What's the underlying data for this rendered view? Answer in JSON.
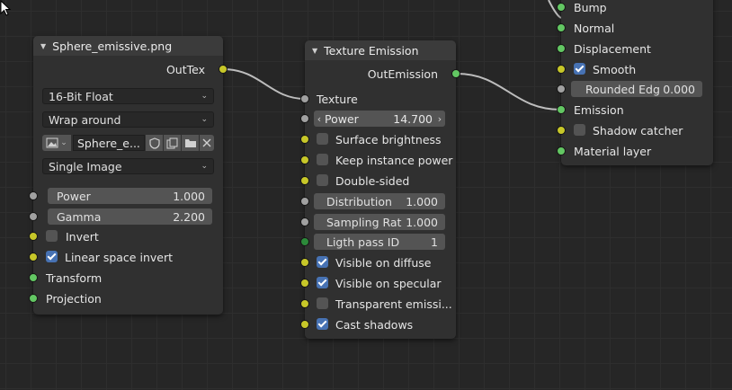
{
  "image_node": {
    "title": "Sphere_emissive.png",
    "output_label": "OutTex",
    "interpolation": "16-Bit Float",
    "extension": "Wrap around",
    "image_name": "Sphere_e...",
    "source": "Single Image",
    "power_label": "Power",
    "power_value": "1.000",
    "gamma_label": "Gamma",
    "gamma_value": "2.200",
    "invert_label": "Invert",
    "linear_invert_label": "Linear space invert",
    "transform_label": "Transform",
    "projection_label": "Projection"
  },
  "emission_node": {
    "title": "Texture Emission",
    "output_label": "OutEmission",
    "texture_label": "Texture",
    "power_label": "Power",
    "power_value": "14.700",
    "surface_brightness": "Surface brightness",
    "keep_instance_power": "Keep instance power",
    "double_sided": "Double-sided",
    "distribution_label": "Distribution",
    "distribution_value": "1.000",
    "sampling_label": "Sampling Rat",
    "sampling_value": "1.000",
    "light_pass_label": "Ligth pass ID",
    "light_pass_value": "1",
    "visible_diffuse": "Visible on diffuse",
    "visible_specular": "Visible on specular",
    "transparent_emission": "Transparent emissi...",
    "cast_shadows": "Cast shadows"
  },
  "material_node": {
    "bump": "Bump",
    "normal": "Normal",
    "displacement": "Displacement",
    "smooth": "Smooth",
    "rounded_label": "Rounded Edg",
    "rounded_value": "0.000",
    "emission": "Emission",
    "shadow_catcher": "Shadow catcher",
    "material_layer": "Material layer"
  },
  "checkboxes": {
    "invert": false,
    "linear_invert": true,
    "surface_brightness": false,
    "keep_instance_power": false,
    "double_sided": false,
    "visible_diffuse": true,
    "visible_specular": true,
    "transparent_emission": false,
    "cast_shadows": true,
    "smooth": true,
    "shadow_catcher": false
  },
  "colors": {
    "socket_gray": "#a1a1a1",
    "socket_yellow": "#c7c729",
    "socket_green": "#63c763",
    "socket_dark_green": "#2c8a3a",
    "checkbox_on": "#4772b3",
    "wire": "#bdbdbd"
  },
  "icons": {
    "collapse": "triangle-down",
    "image_browse": "image-icon",
    "fake_user": "shield-icon",
    "duplicate": "copy-icon",
    "open": "folder-icon",
    "unlink": "close-icon",
    "cursor": "arrow-cursor"
  }
}
